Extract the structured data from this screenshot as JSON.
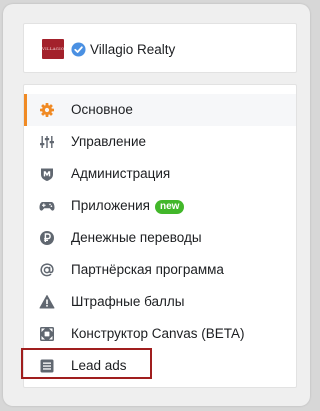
{
  "page": {
    "name": "Villagio Realty",
    "logo_text": "VILLAGIO",
    "verified_icon": "verified-checkmark-icon"
  },
  "menu": {
    "items": [
      {
        "label": "Основное",
        "icon": "gear-icon",
        "active": true
      },
      {
        "label": "Управление",
        "icon": "sliders-icon"
      },
      {
        "label": "Администрация",
        "icon": "shield-icon"
      },
      {
        "label": "Приложения",
        "icon": "gamepad-icon",
        "badge": "new"
      },
      {
        "label": "Денежные переводы",
        "icon": "ruble-coin-icon"
      },
      {
        "label": "Партнёрская программа",
        "icon": "at-sign-icon"
      },
      {
        "label": "Штрафные баллы",
        "icon": "warning-icon"
      },
      {
        "label": "Конструктор Canvas (BETA)",
        "icon": "canvas-icon"
      },
      {
        "label": "Lead ads",
        "icon": "form-icon",
        "highlighted": true
      }
    ]
  },
  "colors": {
    "active_accent": "#f08a24",
    "badge_green": "#42b72a",
    "highlight_border": "#a01e1e",
    "verified_blue": "#4a90e2",
    "logo_red": "#a3212b",
    "icon_gray": "#606770"
  }
}
